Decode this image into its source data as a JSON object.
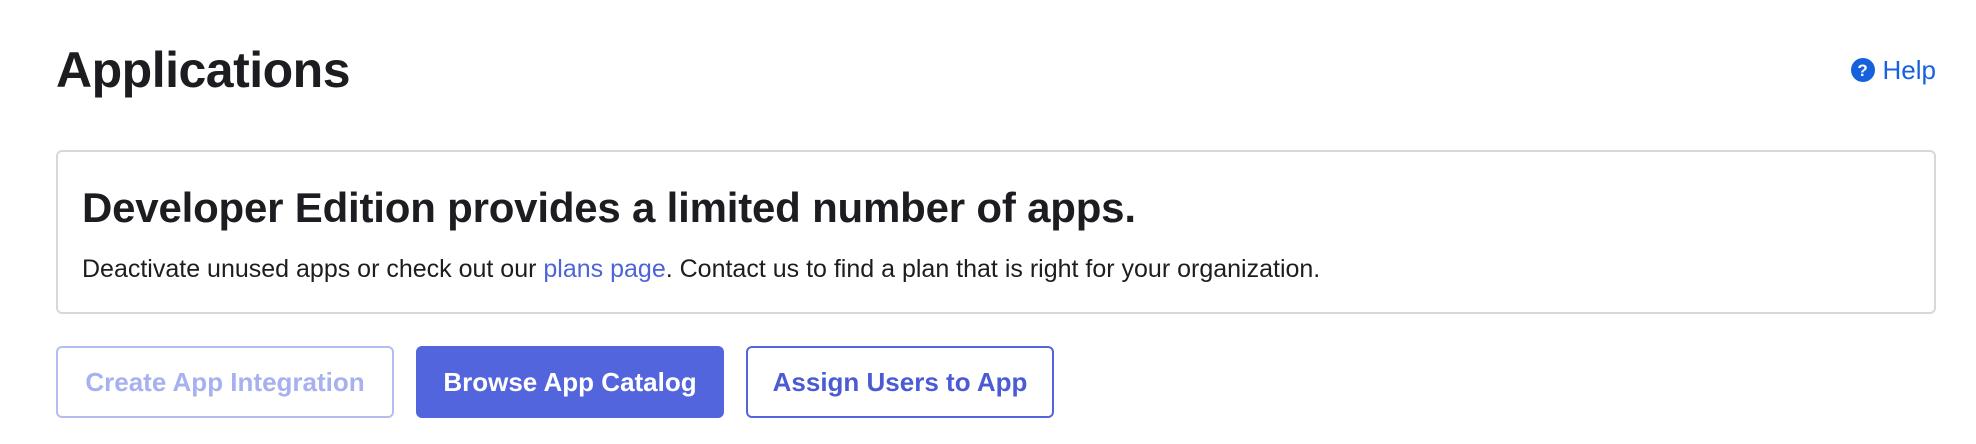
{
  "header": {
    "title": "Applications",
    "help_icon": "question-circle-icon",
    "help_icon_glyph": "?",
    "help_label": "Help"
  },
  "callout": {
    "title": "Developer Edition provides a limited number of apps.",
    "body_before_link": "Deactivate unused apps or check out our ",
    "link_text": "plans page",
    "body_after_link": ". Contact us to find a plan that is right for your organization."
  },
  "actions": {
    "create_label": "Create App Integration",
    "create_state": "disabled",
    "browse_label": "Browse App Catalog",
    "assign_label": "Assign Users to App"
  },
  "colors": {
    "accent": "#5365dd",
    "link": "#1662dd",
    "text": "#1d1d21",
    "border": "#d7d7dc"
  }
}
